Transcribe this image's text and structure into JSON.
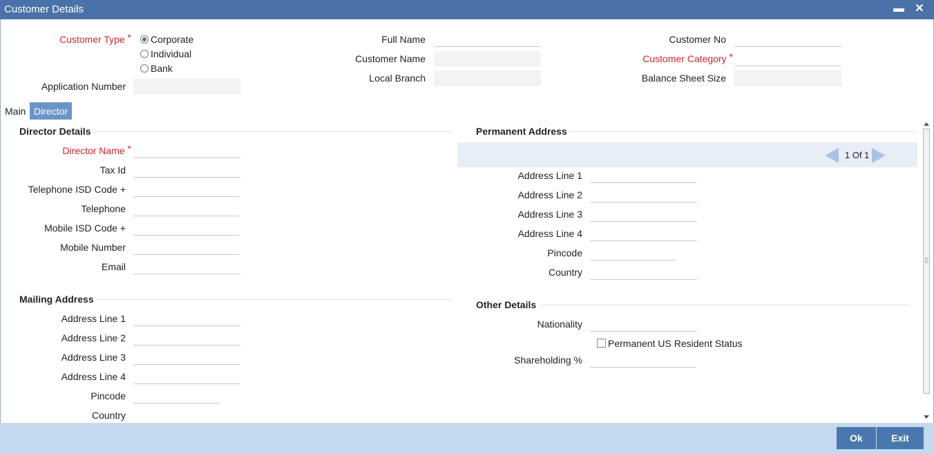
{
  "window": {
    "title": "Customer Details",
    "minimize": "▬",
    "close": "✕"
  },
  "header": {
    "customer_type_label": "Customer Type",
    "customer_type_options": [
      {
        "label": "Corporate",
        "selected": true
      },
      {
        "label": "Individual",
        "selected": false
      },
      {
        "label": "Bank",
        "selected": false
      }
    ],
    "application_number_label": "Application Number",
    "full_name_label": "Full Name",
    "customer_name_label": "Customer Name",
    "local_branch_label": "Local Branch",
    "customer_no_label": "Customer No",
    "customer_category_label": "Customer Category",
    "balance_sheet_size_label": "Balance Sheet Size"
  },
  "tabs": [
    {
      "label": "Main",
      "active": false
    },
    {
      "label": "Director",
      "active": true
    }
  ],
  "director_details": {
    "title": "Director Details",
    "director_name_label": "Director Name",
    "tax_id_label": "Tax Id",
    "telephone_isd_label": "Telephone ISD Code +",
    "telephone_label": "Telephone",
    "mobile_isd_label": "Mobile ISD Code +",
    "mobile_number_label": "Mobile Number",
    "email_label": "Email"
  },
  "mailing_address": {
    "title": "Mailing Address",
    "line1_label": "Address Line 1",
    "line2_label": "Address Line 2",
    "line3_label": "Address Line 3",
    "line4_label": "Address Line 4",
    "pincode_label": "Pincode",
    "country_label": "Country"
  },
  "permanent_address": {
    "title": "Permanent Address",
    "pager_text": "1 Of 1",
    "line1_label": "Address Line 1",
    "line2_label": "Address Line 2",
    "line3_label": "Address Line 3",
    "line4_label": "Address Line 4",
    "pincode_label": "Pincode",
    "country_label": "Country"
  },
  "other_details": {
    "title": "Other Details",
    "nationality_label": "Nationality",
    "us_resident_label": "Permanent US Resident Status",
    "us_resident_checked": false,
    "shareholding_label": "Shareholding %"
  },
  "footer": {
    "ok_label": "Ok",
    "exit_label": "Exit"
  },
  "colors": {
    "titlebar": "#4a72a8",
    "required": "#d0262e",
    "tab_active": "#6b94c9",
    "footer": "#c5d9ee",
    "button": "#4a77ad"
  }
}
